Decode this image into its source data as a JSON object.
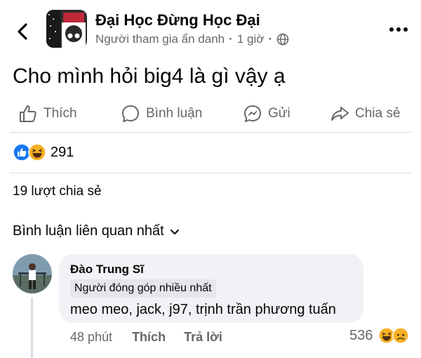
{
  "header": {
    "group_name": "Đại Học Đừng Học Đại",
    "author": "Người tham gia ẩn danh",
    "separator": "·",
    "time": "1 giờ",
    "audience_icon": "globe-icon",
    "more_icon": "more-horizontal-icon"
  },
  "post": {
    "text": "Cho mình hỏi big4 là gì vậy ạ"
  },
  "actions": {
    "like": "Thích",
    "comment": "Bình luận",
    "send": "Gửi",
    "share": "Chia sẻ"
  },
  "reactions": {
    "types": [
      "like",
      "haha"
    ],
    "count": "291"
  },
  "shares_text": "19 lượt chia sẻ",
  "comment_filter": "Bình luận liên quan nhất",
  "comment": {
    "author": "Đào Trung Sĩ",
    "badge": "Người đóng góp nhiều nhất",
    "text": "meo meo, jack, j97, trịnh trần phương tuấn",
    "time": "48 phút",
    "like_label": "Thích",
    "reply_label": "Trả lời",
    "reaction_count": "536",
    "reaction_types": [
      "haha",
      "sad"
    ]
  },
  "colors": {
    "text_primary": "#050505",
    "text_secondary": "#65676b",
    "bubble_bg": "#f0f2f5",
    "like_blue": "#1877f2",
    "haha_yellow": "#f7b125",
    "divider": "#dadde1"
  }
}
